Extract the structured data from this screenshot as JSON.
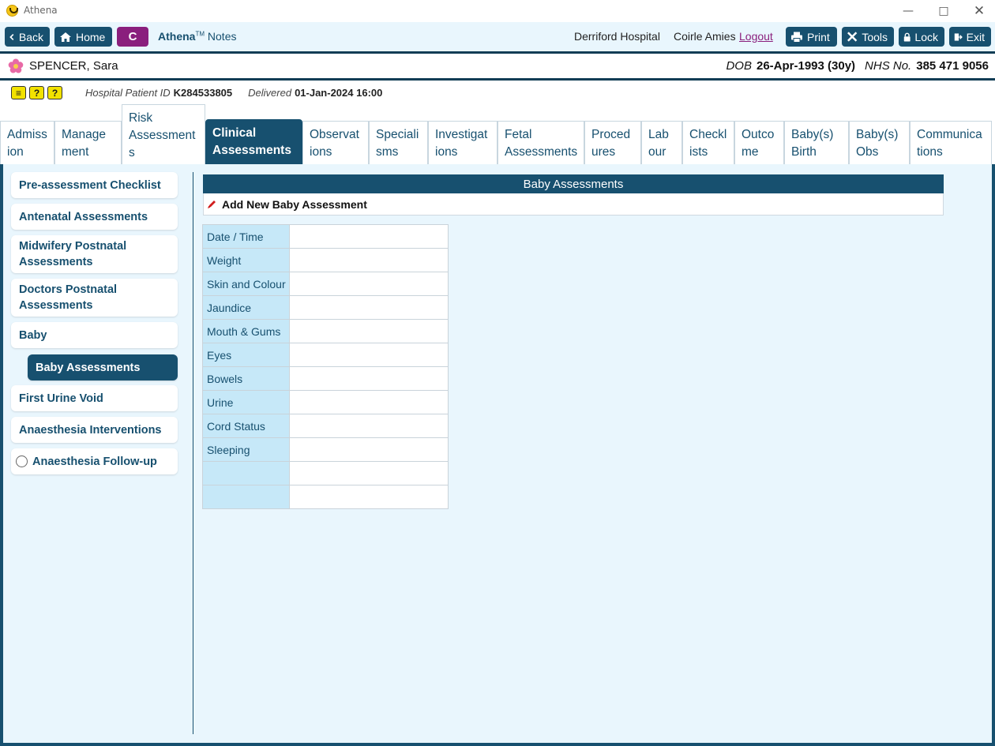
{
  "window": {
    "title": "Athena"
  },
  "toolbar": {
    "back": "Back",
    "home": "Home",
    "c_label": "C",
    "app_brand": "Athena",
    "app_tm": "TM",
    "app_suffix": "Notes",
    "hospital": "Derriford Hospital",
    "user": "Coirle Amies",
    "logout": "Logout",
    "print": "Print",
    "tools": "Tools",
    "lock": "Lock",
    "exit": "Exit"
  },
  "patient": {
    "name": "SPENCER, Sara",
    "dob_label": "DOB",
    "dob_value": "26-Apr-1993 (30y)",
    "nhs_label": "NHS No.",
    "nhs_value": "385 471 9056",
    "hosp_id_label": "Hospital Patient ID",
    "hosp_id_value": "K284533805",
    "delivered_label": "Delivered",
    "delivered_value": "01-Jan-2024 16:00"
  },
  "tabs": [
    {
      "l1": "Admiss",
      "l2": "ion"
    },
    {
      "l1": "Manage",
      "l2": "ment"
    },
    {
      "l1": "Risk",
      "l2": "Assessment",
      "l3": "s"
    },
    {
      "l1": "Clinical",
      "l2": "Assessments"
    },
    {
      "l1": "Observat",
      "l2": "ions"
    },
    {
      "l1": "Speciali",
      "l2": "sms"
    },
    {
      "l1": "Investigat",
      "l2": "ions"
    },
    {
      "l1": "Fetal",
      "l2": "Assessments"
    },
    {
      "l1": "Proced",
      "l2": "ures"
    },
    {
      "l1": "Lab",
      "l2": "our"
    },
    {
      "l1": "Checkl",
      "l2": "ists"
    },
    {
      "l1": "Outco",
      "l2": "me"
    },
    {
      "l1": "Baby(s)",
      "l2": "Birth"
    },
    {
      "l1": "Baby(s)",
      "l2": "Obs"
    },
    {
      "l1": "Communica",
      "l2": "tions"
    }
  ],
  "leftnav": {
    "items": [
      {
        "l1": "Pre-assessment Checklist"
      },
      {
        "l1": "Antenatal Assessments"
      },
      {
        "l1": "Midwifery Postnatal",
        "l2": "Assessments"
      },
      {
        "l1": "Doctors Postnatal",
        "l2": "Assessments"
      },
      {
        "l1": "Baby"
      },
      {
        "l1": "Baby Assessments"
      },
      {
        "l1": "First Urine Void"
      },
      {
        "l1": "Anaesthesia Interventions"
      },
      {
        "l1": "Anaesthesia Follow-up"
      }
    ]
  },
  "panel": {
    "title": "Baby Assessments",
    "add_label": "Add New Baby Assessment"
  },
  "grid": {
    "rows": [
      "Date / Time",
      "Weight",
      "Skin and Colour",
      "Jaundice",
      "Mouth & Gums",
      "Eyes",
      "Bowels",
      "Urine",
      "Cord Status",
      "Sleeping",
      "",
      ""
    ]
  },
  "colors": {
    "primary": "#17506f",
    "accent": "#8a1f7d",
    "bg": "#e9f6fd",
    "label_cell": "#c6e8f8"
  }
}
